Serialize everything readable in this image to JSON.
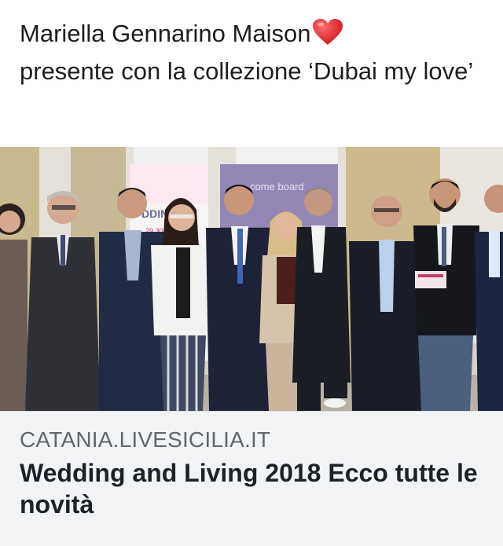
{
  "post": {
    "text": "Mariella Gennarino Maison",
    "text_continued": "presente con la collezione ‘Dubai my love’",
    "emoji": "heart-emoji"
  },
  "photo": {
    "banner_left_text": "DDING",
    "banner_left_subtext": "29 30 30",
    "banner_right_text": "come board"
  },
  "link_preview": {
    "domain": "CATANIA.LIVESICILIA.IT",
    "title": "Wedding and Living 2018 Ecco tutte le novità"
  },
  "colors": {
    "text": "#1c1e21",
    "domain": "#606770",
    "link_bg": "#f2f3f5",
    "heart": "#e0282e"
  }
}
